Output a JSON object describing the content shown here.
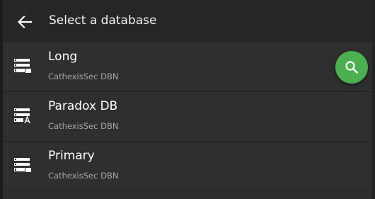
{
  "header": {
    "back_icon": "arrow-left-icon",
    "title": "Select a database"
  },
  "databases": [
    {
      "name": "Long",
      "subtitle": "CathexisSec DBN",
      "icon": "database-server-icon"
    },
    {
      "name": "Paradox DB",
      "subtitle": "CathexisSec DBN",
      "icon": "database-server-a-icon"
    },
    {
      "name": "Primary",
      "subtitle": "CathexisSec DBN",
      "icon": "database-server-icon"
    }
  ],
  "search_button": {
    "icon": "search-icon",
    "color": "#4caf50"
  },
  "colors": {
    "background": "#2e2e2e",
    "header": "#262626",
    "accent": "#4caf50"
  }
}
